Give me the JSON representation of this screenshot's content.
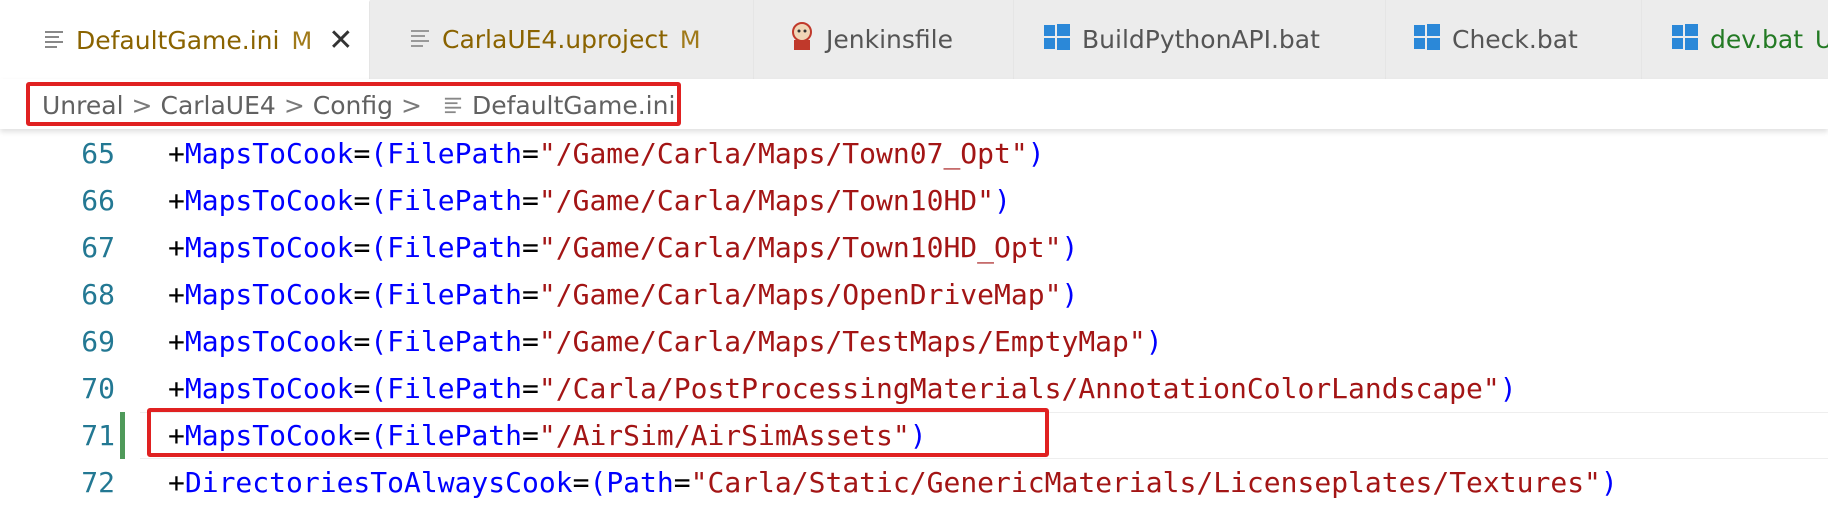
{
  "tabs": [
    {
      "name": "DefaultGame.ini",
      "badge": "M",
      "close": "✕"
    },
    {
      "name": "CarlaUE4.uproject",
      "badge": "M"
    },
    {
      "name": "Jenkinsfile"
    },
    {
      "name": "BuildPythonAPI.bat"
    },
    {
      "name": "Check.bat"
    },
    {
      "name": "dev.bat",
      "badge": "U"
    }
  ],
  "breadcrumb": {
    "items": [
      "Unreal",
      "CarlaUE4",
      "Config",
      "DefaultGame.ini"
    ],
    "sep": ">"
  },
  "lines": [
    {
      "num": "65",
      "plus": "+",
      "key": "MapsToCook",
      "eq": "=",
      "open": "(",
      "param": "FilePath",
      "peq": "=",
      "value": "\"/Game/Carla/Maps/Town07_Opt\"",
      "close": ")"
    },
    {
      "num": "66",
      "plus": "+",
      "key": "MapsToCook",
      "eq": "=",
      "open": "(",
      "param": "FilePath",
      "peq": "=",
      "value": "\"/Game/Carla/Maps/Town10HD\"",
      "close": ")"
    },
    {
      "num": "67",
      "plus": "+",
      "key": "MapsToCook",
      "eq": "=",
      "open": "(",
      "param": "FilePath",
      "peq": "=",
      "value": "\"/Game/Carla/Maps/Town10HD_Opt\"",
      "close": ")"
    },
    {
      "num": "68",
      "plus": "+",
      "key": "MapsToCook",
      "eq": "=",
      "open": "(",
      "param": "FilePath",
      "peq": "=",
      "value": "\"/Game/Carla/Maps/OpenDriveMap\"",
      "close": ")"
    },
    {
      "num": "69",
      "plus": "+",
      "key": "MapsToCook",
      "eq": "=",
      "open": "(",
      "param": "FilePath",
      "peq": "=",
      "value": "\"/Game/Carla/Maps/TestMaps/EmptyMap\"",
      "close": ")"
    },
    {
      "num": "70",
      "plus": "+",
      "key": "MapsToCook",
      "eq": "=",
      "open": "(",
      "param": "FilePath",
      "peq": "=",
      "value": "\"/Carla/PostProcessingMaterials/AnnotationColorLandscape\"",
      "close": ")"
    },
    {
      "num": "71",
      "plus": "+",
      "key": "MapsToCook",
      "eq": "=",
      "open": "(",
      "param": "FilePath",
      "peq": "=",
      "value": "\"/AirSim/AirSimAssets\"",
      "close": ")"
    },
    {
      "num": "72",
      "plus": "+",
      "key": "DirectoriesToAlwaysCook",
      "eq": "=",
      "open": "(",
      "param": "Path",
      "peq": "=",
      "value": "\"Carla/Static/GenericMaterials/Licenseplates/Textures\"",
      "close": ")"
    }
  ],
  "colors": {
    "keyword": "#0000ff",
    "string": "#a31515",
    "line_number": "#237893",
    "highlight_box": "#e02121",
    "modified_badge": "#a07a1a",
    "added_line_gutter": "#4f9a5a"
  },
  "icons": {
    "file_tab": "lines-file-icon",
    "jenkins": "jenkins-icon",
    "bat": "windows-icon"
  }
}
